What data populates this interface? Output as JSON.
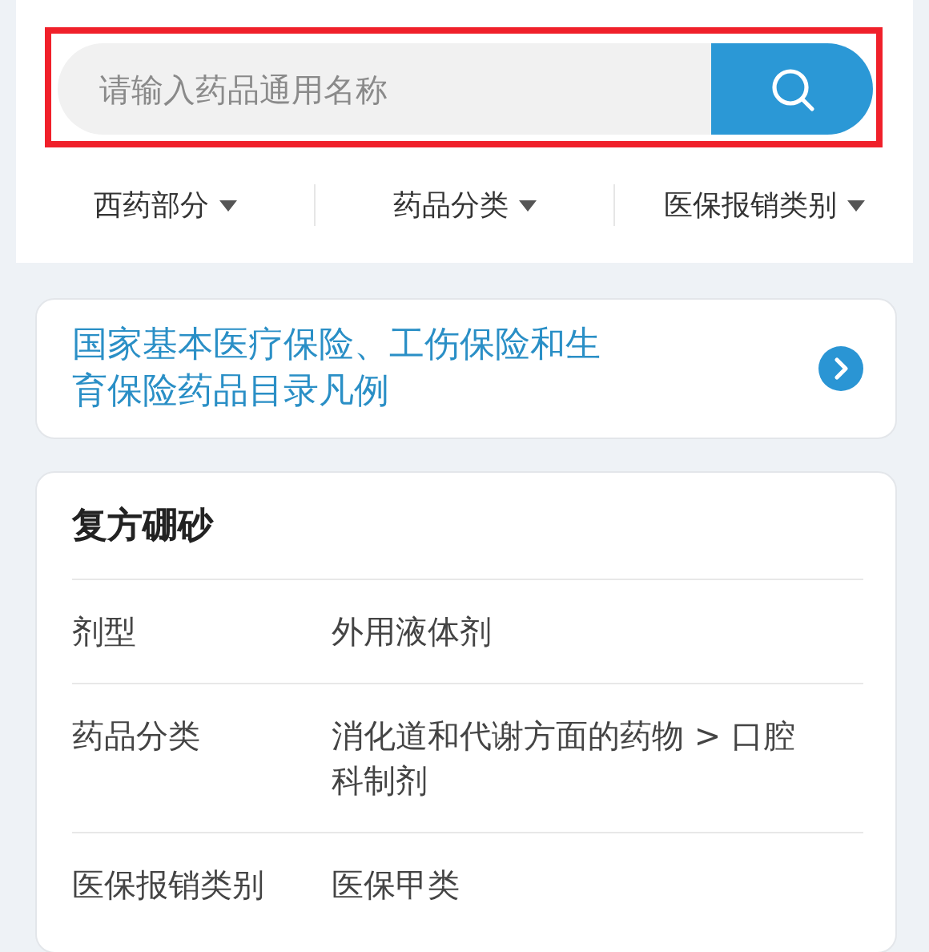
{
  "search": {
    "placeholder": "请输入药品通用名称",
    "highlighted": true
  },
  "filters": [
    {
      "label": "西药部分"
    },
    {
      "label": "药品分类"
    },
    {
      "label": "医保报销类别"
    }
  ],
  "notice": {
    "text": "国家基本医疗保险、工伤保险和生育保险药品目录凡例"
  },
  "drug": {
    "name": "复方硼砂",
    "rows": [
      {
        "label": "剂型",
        "value": "外用液体剂"
      },
      {
        "label": "药品分类",
        "value": "消化道和代谢方面的药物 > 口腔科制剂"
      },
      {
        "label": "医保报销类别",
        "value": "医保甲类"
      }
    ]
  }
}
